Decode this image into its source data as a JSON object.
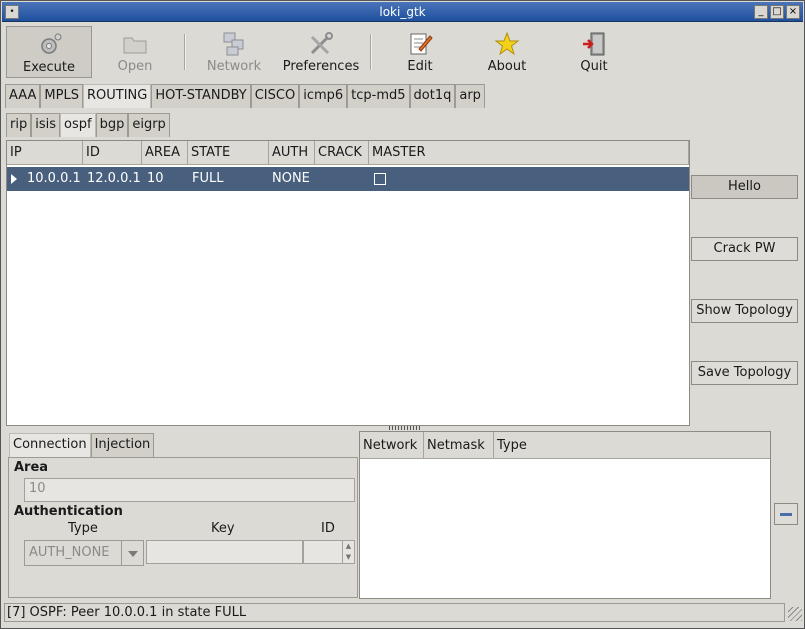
{
  "window": {
    "title": "loki_gtk"
  },
  "toolbar": {
    "execute": "Execute",
    "open": "Open",
    "network": "Network",
    "preferences": "Preferences",
    "edit": "Edit",
    "about": "About",
    "quit": "Quit"
  },
  "main_tabs": [
    "AAA",
    "MPLS",
    "ROUTING",
    "HOT-STANDBY",
    "CISCO",
    "icmp6",
    "tcp-md5",
    "dot1q",
    "arp"
  ],
  "sub_tabs": [
    "rip",
    "isis",
    "ospf",
    "bgp",
    "eigrp"
  ],
  "peers": {
    "columns": [
      "IP",
      "ID",
      "AREA",
      "STATE",
      "AUTH",
      "CRACK",
      "MASTER"
    ],
    "rows": [
      {
        "ip": "10.0.0.1",
        "id": "12.0.0.1",
        "area": "10",
        "state": "FULL",
        "auth": "NONE",
        "crack": "",
        "master": false
      }
    ]
  },
  "actions": {
    "hello": "Hello",
    "crack_pw": "Crack PW",
    "show_topology": "Show Topology",
    "save_topology": "Save Topology"
  },
  "details": {
    "tabs": [
      "Connection",
      "Injection"
    ],
    "area_label": "Area",
    "area_value": "10",
    "auth_label": "Authentication",
    "type_label": "Type",
    "key_label": "Key",
    "id_label": "ID",
    "auth_type": "AUTH_NONE",
    "key_value": "",
    "id_value": ""
  },
  "networks": {
    "columns": [
      "Network",
      "Netmask",
      "Type"
    ]
  },
  "status": "[7] OSPF: Peer 10.0.0.1 in state FULL"
}
